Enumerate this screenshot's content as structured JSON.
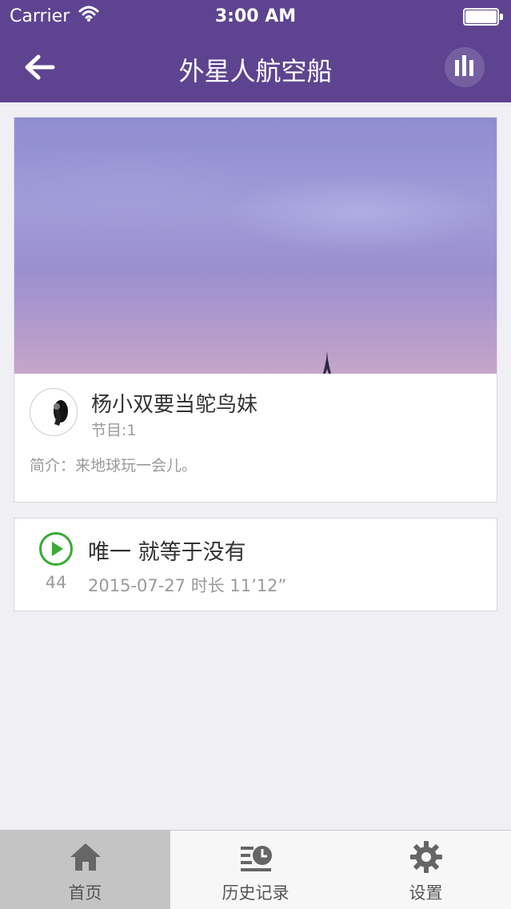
{
  "status_bar": {
    "carrier": "Carrier",
    "time": "3:00 AM"
  },
  "nav": {
    "back_icon": "back-arrow-icon",
    "title": "外星人航空船",
    "playing_icon": "equalizer-icon",
    "bar_color": "#5e4490"
  },
  "album": {
    "name": "杨小双要当鸵鸟妹",
    "episodes": "节目:1",
    "intro": "简介：来地球玩一会儿。"
  },
  "episode": {
    "play_icon": "play-icon",
    "title": "唯一 就等于没有",
    "count": "44",
    "meta": "2015-07-27  时长 11’12”",
    "accent": "#3aaa35"
  },
  "tabbar": {
    "tabs": [
      {
        "label": "首页",
        "icon": "home-icon",
        "active": true
      },
      {
        "label": "历史记录",
        "icon": "history-icon",
        "active": false
      },
      {
        "label": "设置",
        "icon": "gear-icon",
        "active": false
      }
    ]
  }
}
